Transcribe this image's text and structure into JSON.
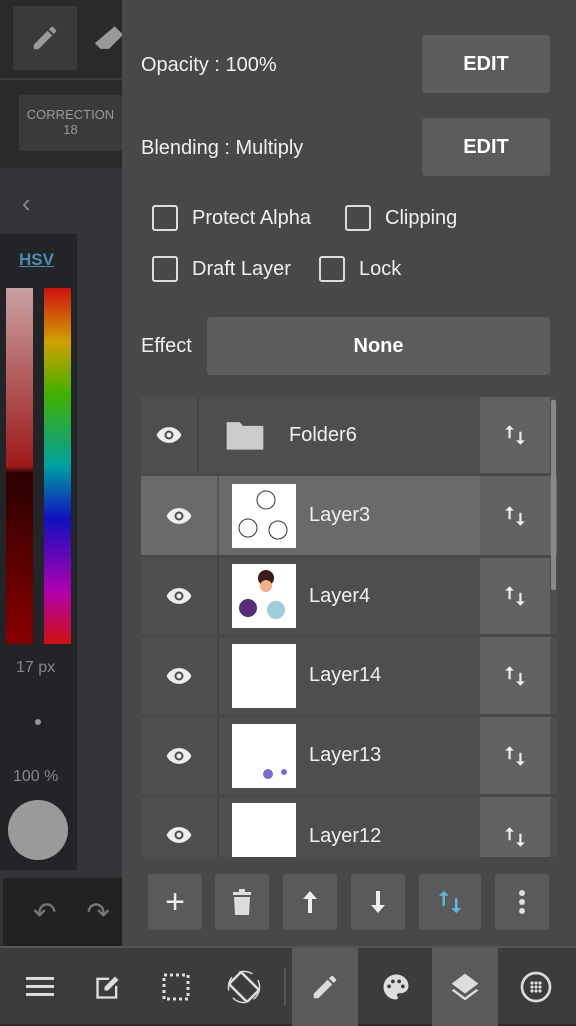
{
  "left": {
    "correction_label": "CORRECTION",
    "correction_value": "18",
    "color_mode": "HSV",
    "brush_size": "17 px",
    "brush_opacity": "100 %"
  },
  "layer_panel": {
    "opacity_label": "Opacity : 100%",
    "blending_label": "Blending : Multiply",
    "edit_label": "EDIT",
    "checkboxes": [
      {
        "label": "Protect Alpha",
        "checked": false
      },
      {
        "label": "Clipping",
        "checked": false
      },
      {
        "label": "Draft Layer",
        "checked": false
      },
      {
        "label": "Lock",
        "checked": false
      }
    ],
    "effect_label": "Effect",
    "effect_value": "None",
    "layers": [
      {
        "name": "Folder6",
        "type": "folder",
        "visible": true
      },
      {
        "name": "Layer3",
        "selected": true,
        "visible": true
      },
      {
        "name": "Layer4",
        "visible": true
      },
      {
        "name": "Layer14",
        "visible": true
      },
      {
        "name": "Layer13",
        "visible": true
      },
      {
        "name": "Layer12",
        "visible": true
      }
    ]
  },
  "colors": {
    "accent": "#5bb8e0",
    "panel": "#484848"
  }
}
